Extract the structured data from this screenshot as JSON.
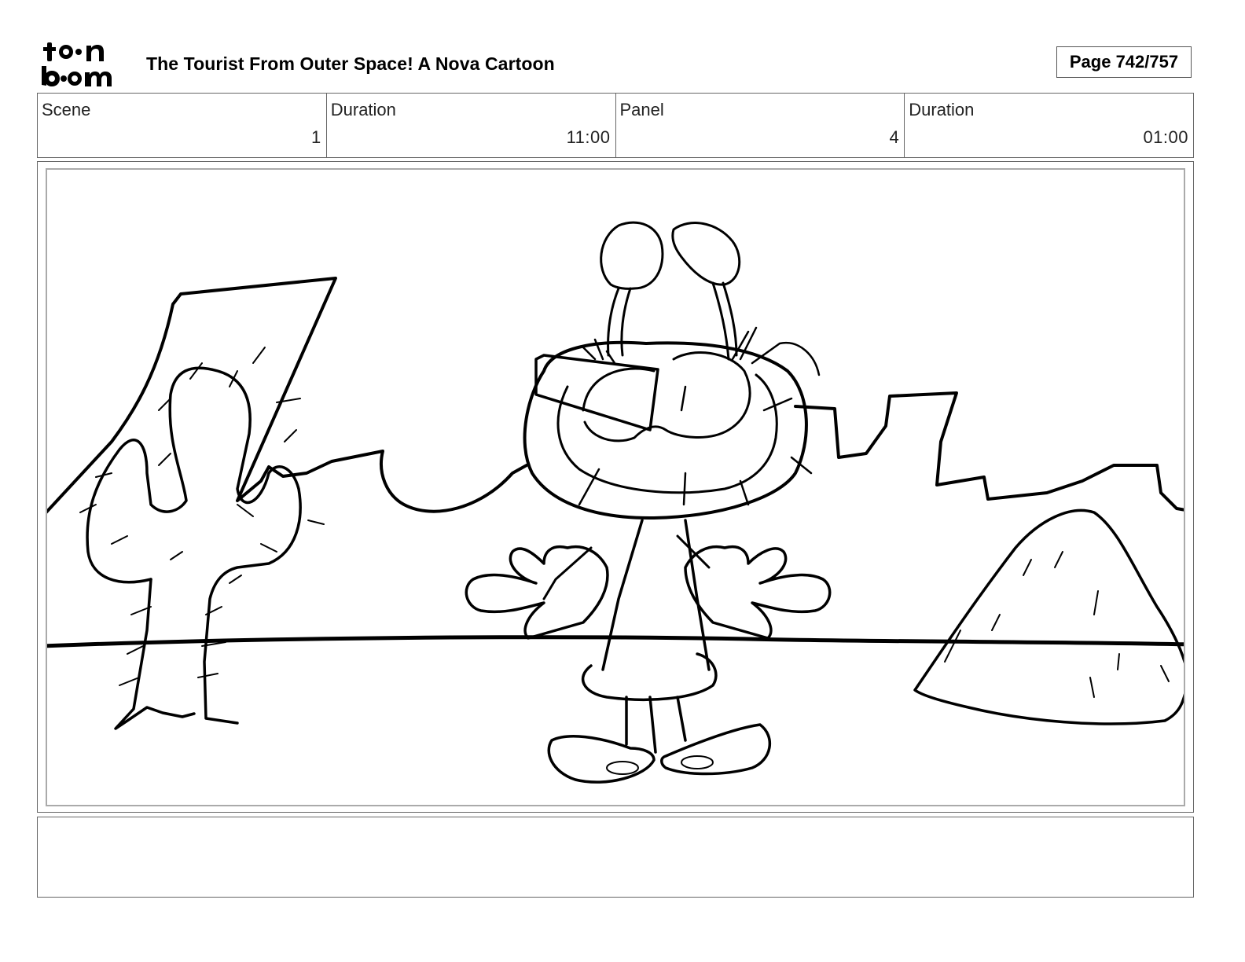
{
  "header": {
    "logo_label": "toonboom",
    "title": "The Tourist From Outer Space!  A Nova Cartoon",
    "page": "Page 742/757"
  },
  "info": {
    "scene_label": "Scene",
    "scene_value": "1",
    "scene_duration_label": "Duration",
    "scene_duration_value": "11:00",
    "panel_label": "Panel",
    "panel_value": "4",
    "panel_duration_label": "Duration",
    "panel_duration_value": "01:00"
  },
  "panel": {
    "sketch": "desert-scene-alien-character-sketch"
  },
  "notes": {
    "text": ""
  }
}
